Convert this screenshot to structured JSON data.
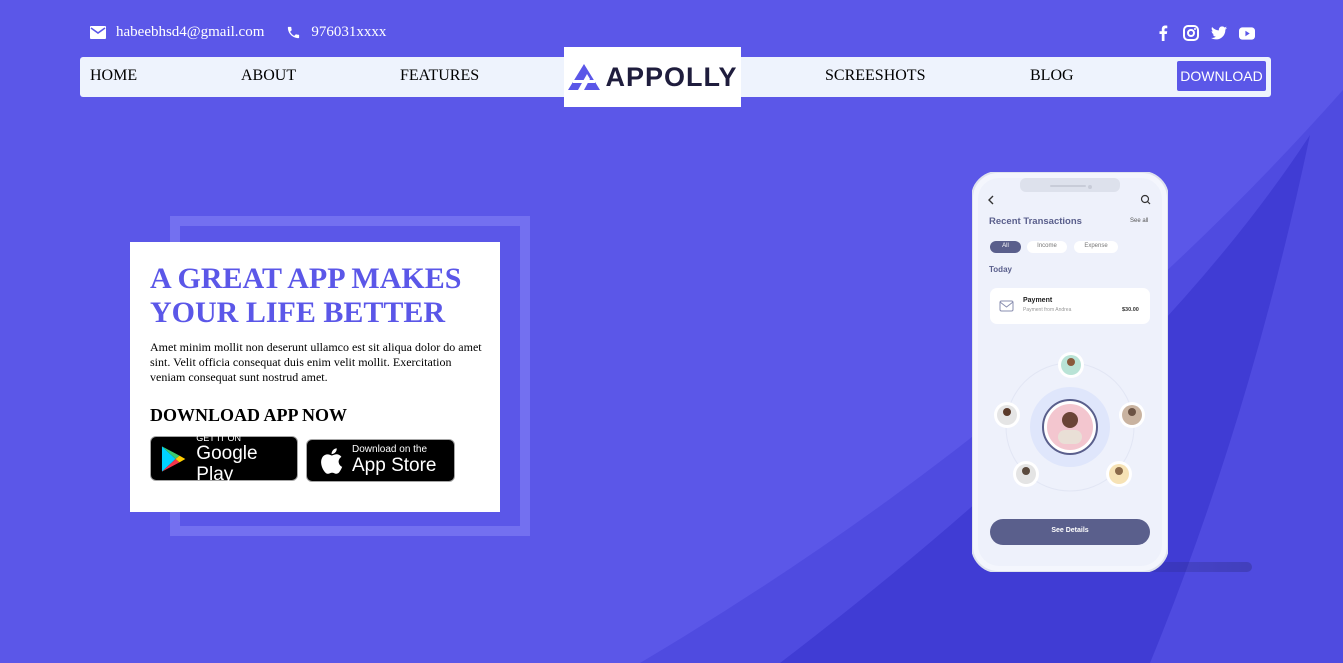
{
  "contact": {
    "email": "habeebhsd4@gmail.com",
    "phone": "976031xxxx"
  },
  "social_icons": [
    "facebook-icon",
    "instagram-icon",
    "twitter-icon",
    "youtube-icon"
  ],
  "nav": {
    "home": "HOME",
    "about": "ABOUT",
    "features": "FEATURES",
    "screenshots": "SCREESHOTS",
    "blog": "BLOG",
    "download": "DOWNLOAD"
  },
  "logo": {
    "text": "APPOLLY"
  },
  "hero": {
    "title": "A GREAT APP MAKES YOUR LIFE BETTER",
    "body": "Amet minim mollit non deserunt ullamco est sit aliqua dolor do amet sint. Velit officia consequat duis enim velit mollit. Exercitation veniam consequat sunt nostrud amet.",
    "cta": "DOWNLOAD APP NOW",
    "google_play": {
      "small": "GET IT ON",
      "big": "Google Play"
    },
    "app_store": {
      "small": "Download on the",
      "big": "App Store"
    }
  },
  "phone": {
    "title": "Recent Transactions",
    "see_all": "See all",
    "filters": [
      "All",
      "Income",
      "Expense"
    ],
    "section": "Today",
    "payment_title": "Payment",
    "payment_sub": "Payment from Andrea",
    "payment_amount": "$30.00",
    "button": "See Details"
  },
  "colors": {
    "primary": "#5b57e8",
    "nav_bg": "#eef3fd",
    "dark_text": "#1f1d3d"
  }
}
